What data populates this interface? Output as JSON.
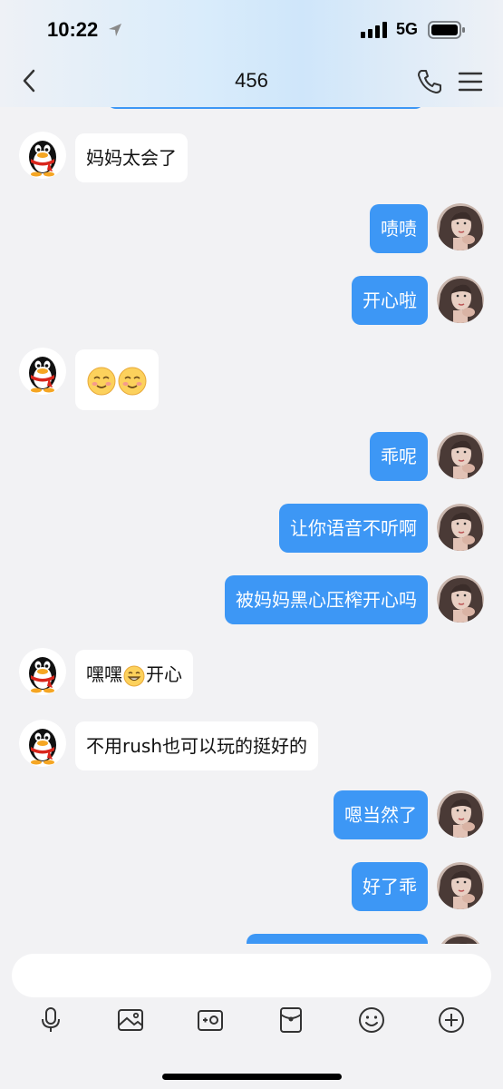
{
  "status_bar": {
    "time": "10:22",
    "network": "5G"
  },
  "header": {
    "title": "456"
  },
  "messages": [
    {
      "side": "in",
      "text": "妈妈太会了"
    },
    {
      "side": "out",
      "text": "啧啧"
    },
    {
      "side": "out",
      "text": "开心啦"
    },
    {
      "side": "in",
      "emoji": "smiling-blush-emoji x2"
    },
    {
      "side": "out",
      "text": "乖呢"
    },
    {
      "side": "out",
      "text": "让你语音不听啊"
    },
    {
      "side": "out",
      "text": "被妈妈黑心压榨开心吗"
    },
    {
      "side": "in",
      "text_before": "嘿嘿",
      "emoji": "grinning-emoji",
      "text_after": "开心"
    },
    {
      "side": "in",
      "text": "不用rush也可以玩的挺好的"
    },
    {
      "side": "out",
      "text": "嗯当然了"
    },
    {
      "side": "out",
      "text": "好了乖"
    }
  ],
  "toolbar": [
    "microphone-icon",
    "image-icon",
    "camera-icon",
    "red-packet-icon",
    "emoji-icon",
    "plus-icon"
  ],
  "colors": {
    "outgoing_bubble": "#3d97f5",
    "incoming_bubble": "#ffffff",
    "background": "#f2f2f4"
  }
}
